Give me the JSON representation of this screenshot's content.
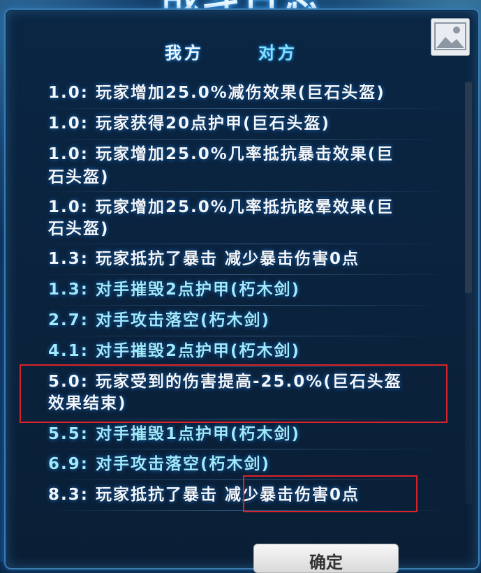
{
  "header": {
    "title": "战斗日志"
  },
  "tabs": [
    {
      "label": "我方"
    },
    {
      "label": "对方"
    }
  ],
  "log": [
    {
      "text": "1.0: 玩家增加25.0%减伤效果(巨石头盔)",
      "side": "player"
    },
    {
      "text": "1.0: 玩家获得20点护甲(巨石头盔)",
      "side": "player"
    },
    {
      "text": "1.0: 玩家增加25.0%几率抵抗暴击效果(巨",
      "text2": "石头盔)",
      "side": "player"
    },
    {
      "text": "1.0: 玩家增加25.0%几率抵抗眩晕效果(巨",
      "text2": "石头盔)",
      "side": "player"
    },
    {
      "text": "1.3: 玩家抵抗了暴击 减少暴击伤害0点",
      "side": "player"
    },
    {
      "text": "1.3: 对手摧毁2点护甲(朽木剑)",
      "side": "enemy"
    },
    {
      "text": "2.7: 对手攻击落空(朽木剑)",
      "side": "enemy"
    },
    {
      "text": "4.1: 对手摧毁2点护甲(朽木剑)",
      "side": "enemy"
    },
    {
      "text": "5.0: 玩家受到的伤害提高-25.0%(巨石头盔",
      "text2": "效果结束)",
      "side": "player"
    },
    {
      "text": "5.5: 对手摧毁1点护甲(朽木剑)",
      "side": "enemy"
    },
    {
      "text": "6.9: 对手攻击落空(朽木剑)",
      "side": "enemy"
    },
    {
      "text": "8.3: 玩家抵抗了暴击 减少暴击伤害0点",
      "side": "player"
    }
  ],
  "button": {
    "label": "确定"
  },
  "colors": {
    "player_text": "#f1f7ff",
    "enemy_text": "#9eeaff",
    "highlight": "#d8232a",
    "panel_border": "#3a7bb0"
  },
  "icons": {
    "corner_image": "image-placeholder-icon"
  }
}
